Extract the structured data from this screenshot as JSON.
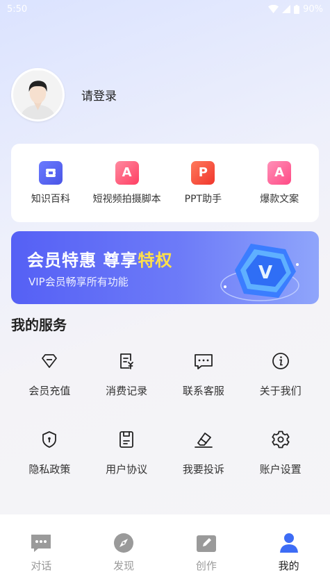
{
  "status_bar": {
    "time": "5:50",
    "battery": "90%"
  },
  "profile": {
    "login_text": "请登录"
  },
  "quick_actions": [
    {
      "label": "知识百科",
      "icon": "knowledge-icon",
      "color": "#5563f2"
    },
    {
      "label": "短视频拍摄脚本",
      "icon": "letter-a-icon",
      "color": "#ff4d6a"
    },
    {
      "label": "PPT助手",
      "icon": "letter-p-icon",
      "color": "#f44a3c"
    },
    {
      "label": "爆款文案",
      "icon": "letter-a-icon",
      "color": "#ff4d8f"
    }
  ],
  "vip_banner": {
    "title_main": "会员特惠 尊享",
    "title_highlight": "特权",
    "subtitle": "VIP会员畅享所有功能",
    "badge_letter": "V"
  },
  "services": {
    "title": "我的服务",
    "items": [
      {
        "label": "会员充值",
        "icon": "diamond-icon"
      },
      {
        "label": "消费记录",
        "icon": "receipt-icon"
      },
      {
        "label": "联系客服",
        "icon": "chat-icon"
      },
      {
        "label": "关于我们",
        "icon": "info-icon"
      },
      {
        "label": "隐私政策",
        "icon": "shield-icon"
      },
      {
        "label": "用户协议",
        "icon": "document-icon"
      },
      {
        "label": "我要投诉",
        "icon": "eraser-icon"
      },
      {
        "label": "账户设置",
        "icon": "gear-icon"
      }
    ]
  },
  "tabbar": {
    "items": [
      {
        "label": "对话",
        "icon": "chat-bubble-icon",
        "active": false
      },
      {
        "label": "发现",
        "icon": "compass-icon",
        "active": false
      },
      {
        "label": "创作",
        "icon": "pencil-icon",
        "active": false
      },
      {
        "label": "我的",
        "icon": "person-icon",
        "active": true
      }
    ],
    "active_color": "#3d6cf5",
    "inactive_color": "#9a9a9a"
  }
}
